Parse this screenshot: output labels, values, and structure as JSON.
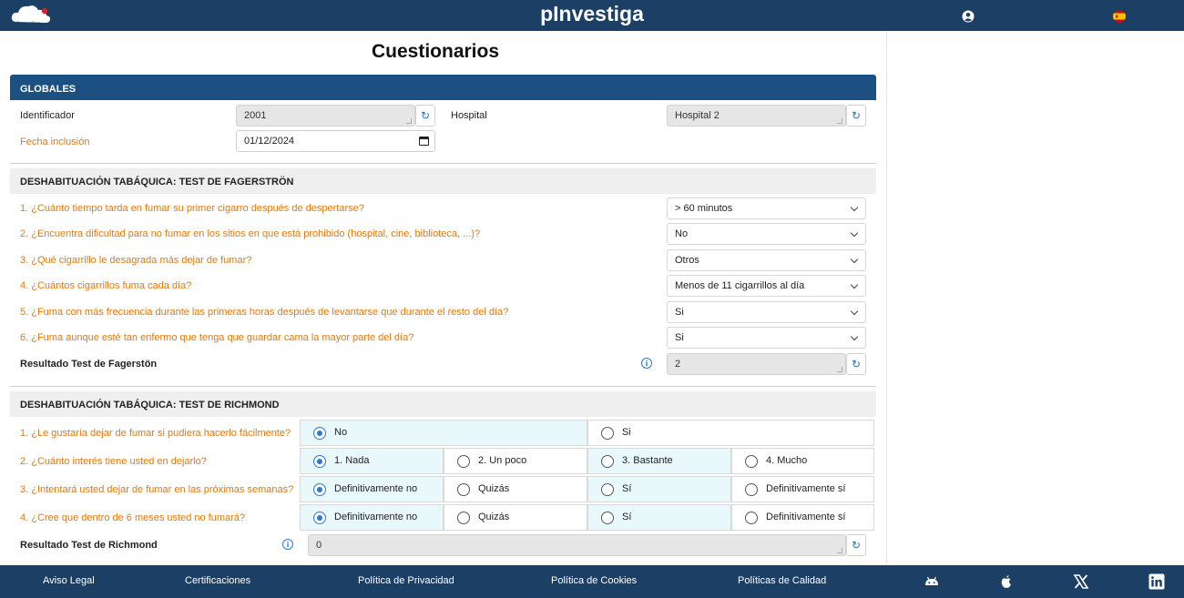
{
  "header": {
    "logo_text": "pInvestiga",
    "brand": "pInvestiga"
  },
  "page_title": "Cuestionarios",
  "globales": {
    "title": "GLOBALES",
    "identificador_label": "Identificador",
    "identificador_value": "2001",
    "hospital_label": "Hospital",
    "hospital_value": "Hospital 2",
    "fecha_label": "Fecha inclusión",
    "fecha_value": "01/12/2024"
  },
  "fagerstrom": {
    "title": "DESHABITUACIÓN TABÁQUICA: TEST DE FAGERSTRÖN",
    "questions": [
      {
        "text": "1. ¿Cuánto tiempo tarda en fumar su primer cigarro después de despertarse?",
        "value": "> 60 minutos"
      },
      {
        "text": "2. ¿Encuentra dificultad para no fumar en los sitios en que está prohibido (hospital, cine, biblioteca, ...)?",
        "value": "No"
      },
      {
        "text": "3. ¿Qué cigarrillo le desagrada más dejar de fumar?",
        "value": "Otros"
      },
      {
        "text": "4. ¿Cuántos cigarrillos fuma cada día?",
        "value": "Menos de 11 cigarrillos al día"
      },
      {
        "text": "5. ¿Fuma con más frecuencia durante las primeras horas después de levantarse que durante el resto del día?",
        "value": "Si"
      },
      {
        "text": "6. ¿Fuma aunque esté tan enfermo que tenga que guardar cama la mayor parte del día?",
        "value": "Si"
      }
    ],
    "result_label": "Resultado Test de Fagerstön",
    "result_value": "2"
  },
  "richmond": {
    "title": "DESHABITUACIÓN TABÁQUICA: TEST DE RICHMOND",
    "questions": [
      {
        "text": "1. ¿Le gustaría dejar de fumar si pudiera hacerlo fácilmente?",
        "options": [
          "No",
          "Si"
        ],
        "selected": 0
      },
      {
        "text": "2. ¿Cuánto interés tiene usted en dejarlo?",
        "options": [
          "1. Nada",
          "2. Un poco",
          "3. Bastante",
          "4. Mucho"
        ],
        "selected": 0
      },
      {
        "text": "3. ¿Intentará usted dejar de fumar en las próximas semanas?",
        "options": [
          "Definitivamente no",
          "Quizás",
          "Sí",
          "Definitivamente sí"
        ],
        "selected": 0
      },
      {
        "text": "4. ¿Cree que dentro de 6 meses usted no fumará?",
        "options": [
          "Definitivamente no",
          "Quizás",
          "Sí",
          "Definitivamente sí"
        ],
        "selected": 0
      }
    ],
    "result_label": "Resultado Test de Richmond",
    "result_value": "0"
  },
  "footer": {
    "links": [
      "Aviso Legal",
      "Certificaciones",
      "Política de Privacidad",
      "Política de Cookies",
      "Políticas de Calidad"
    ],
    "icons": [
      "android-icon",
      "apple-icon",
      "x-icon",
      "linkedin-icon"
    ]
  },
  "colors": {
    "header_bg": "#1c3f66",
    "section_dark": "#1c5082",
    "label_orange": "#e07a10",
    "radio_blue": "#2a78d8",
    "selected_bg": "#e9f9fb"
  }
}
